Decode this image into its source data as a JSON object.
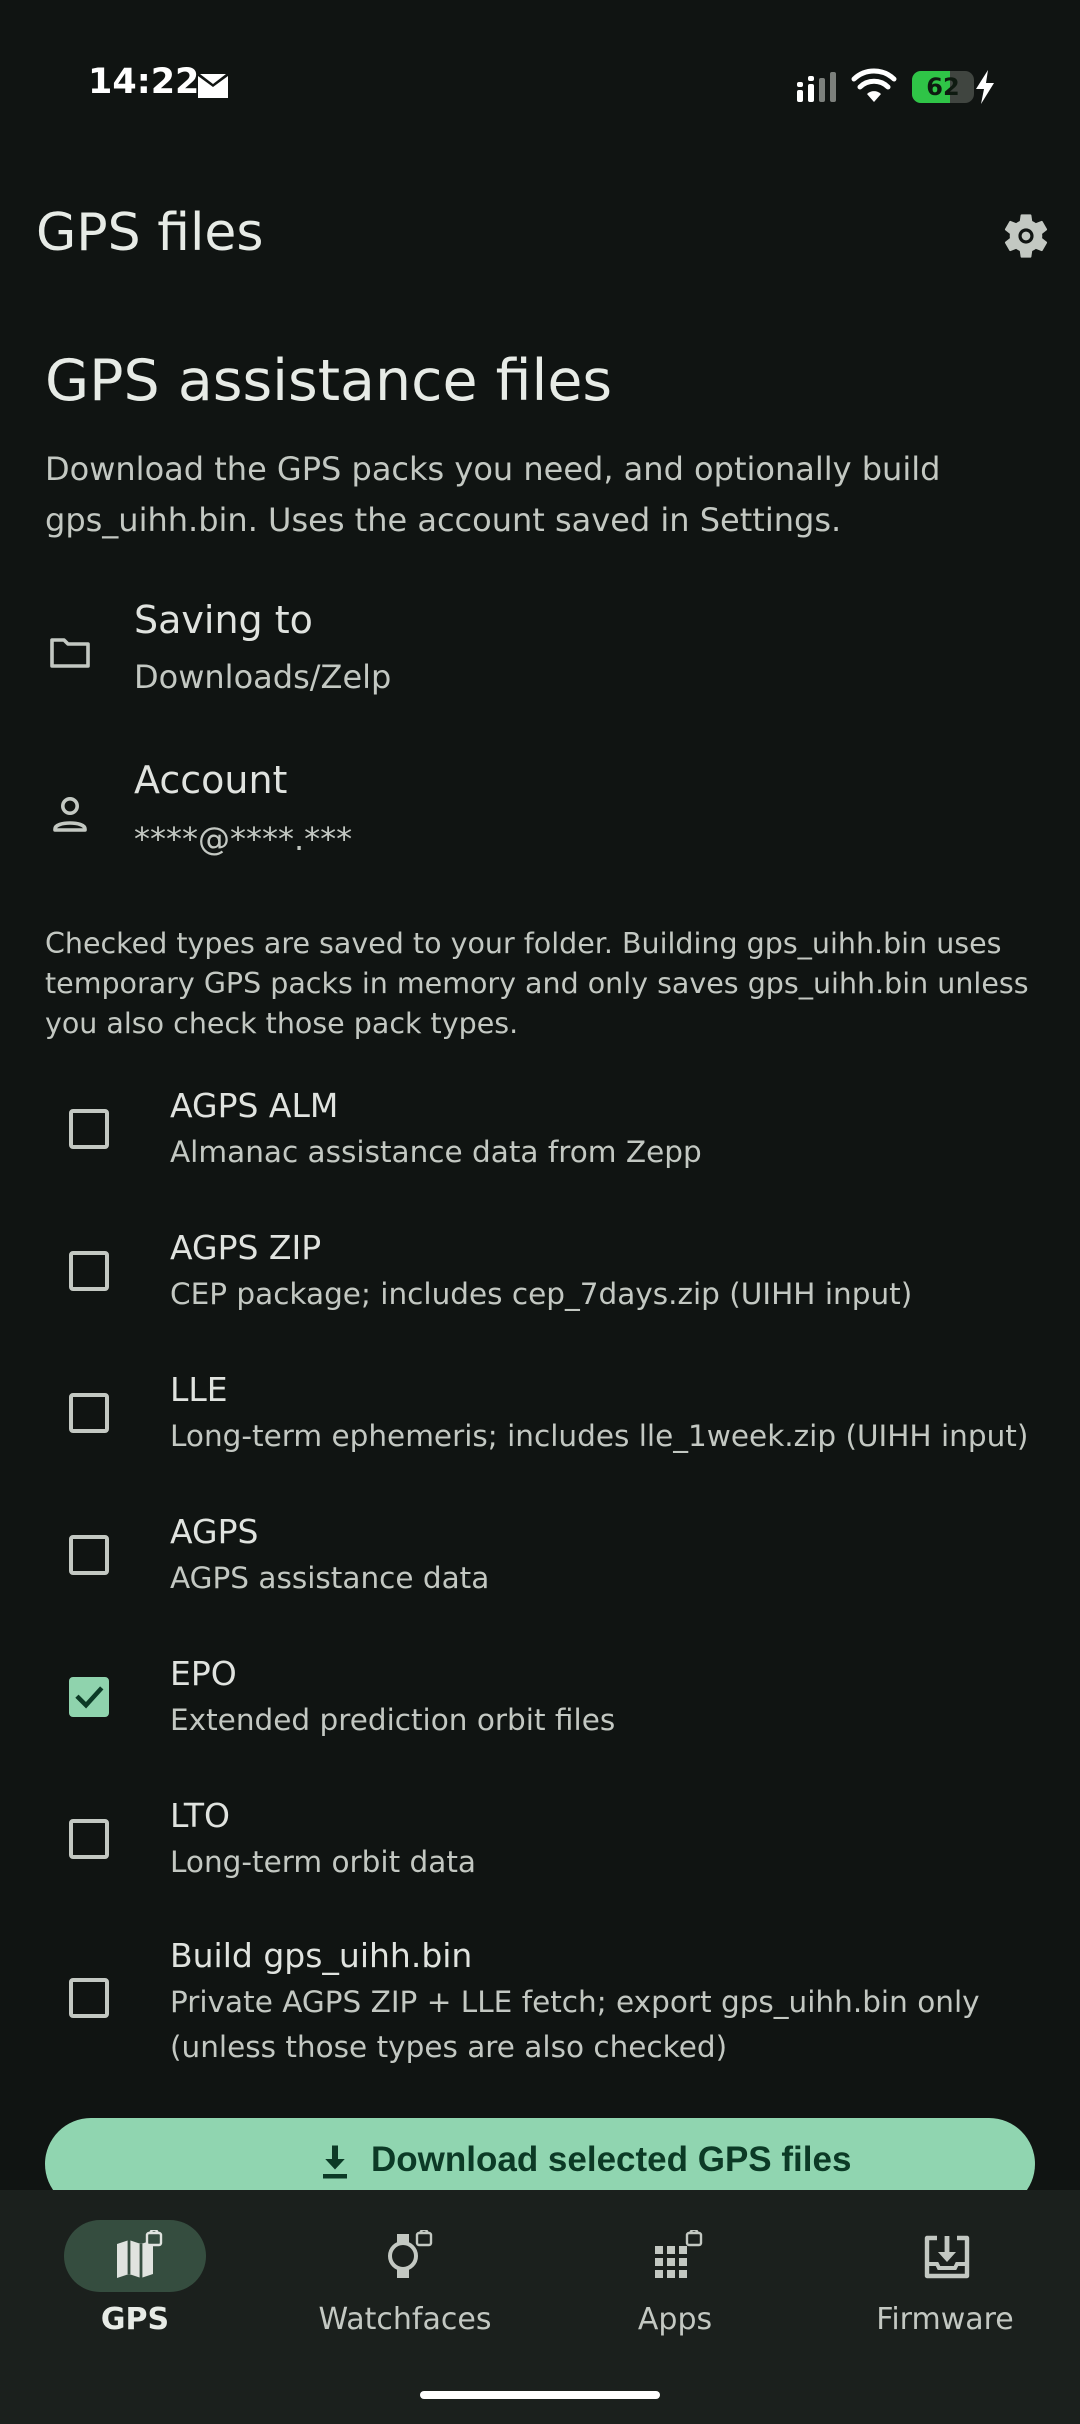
{
  "status_bar": {
    "time": "14:22",
    "battery_level": 62,
    "battery_label": "62",
    "icons": [
      "mail-icon",
      "signal-icon",
      "wifi-icon",
      "charging-bolt-icon"
    ],
    "battery_color": "#2fc447"
  },
  "app_bar": {
    "title": "GPS files",
    "action_icon": "gear-icon"
  },
  "content": {
    "heading": "GPS assistance files",
    "description": "Download the GPS packs you need, and optionally build gps_uihh.bin. Uses the account saved in Settings.",
    "saving_to": {
      "label": "Saving to",
      "value": "Downloads/Zelp",
      "icon": "folder-icon"
    },
    "account": {
      "label": "Account",
      "value": "****@****.***",
      "icon": "person-icon"
    },
    "note": "Checked types are saved to your folder. Building gps_uihh.bin uses temporary GPS packs in memory and only saves gps_uihh.bin unless you also check those pack types.",
    "options": [
      {
        "title": "AGPS ALM",
        "desc": "Almanac assistance data from Zepp",
        "checked": false
      },
      {
        "title": "AGPS ZIP",
        "desc": "CEP package; includes cep_7days.zip (UIHH input)",
        "checked": false
      },
      {
        "title": "LLE",
        "desc": "Long-term ephemeris; includes lle_1week.zip (UIHH input)",
        "checked": false
      },
      {
        "title": "AGPS",
        "desc": "AGPS assistance data",
        "checked": false
      },
      {
        "title": "EPO",
        "desc": "Extended prediction orbit files",
        "checked": true
      },
      {
        "title": "LTO",
        "desc": "Long-term orbit data",
        "checked": false
      },
      {
        "title": "Build gps_uihh.bin",
        "desc": "Private AGPS ZIP + LLE fetch; export gps_uihh.bin only (unless those types are also checked)",
        "checked": false
      }
    ],
    "download_button": {
      "label": "Download selected GPS files",
      "icon": "download-icon"
    }
  },
  "bottom_nav": {
    "items": [
      {
        "label": "GPS",
        "icon": "map-lock-icon",
        "active": true
      },
      {
        "label": "Watchfaces",
        "icon": "watch-lock-icon",
        "active": false
      },
      {
        "label": "Apps",
        "icon": "apps-grid-lock-icon",
        "active": false
      },
      {
        "label": "Firmware",
        "icon": "firmware-download-icon",
        "active": false
      }
    ]
  },
  "colors": {
    "background": "#101412",
    "accent": "#90d5b0",
    "nav_background": "#1b201d",
    "active_pill": "#354d3f"
  }
}
